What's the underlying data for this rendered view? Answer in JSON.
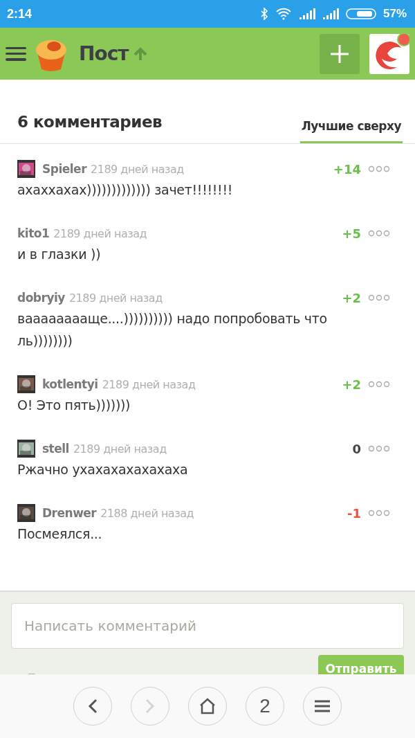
{
  "status_bar": {
    "time": "2:14",
    "battery": "57%"
  },
  "header": {
    "title": "Пост"
  },
  "comments_header": {
    "count": "6 комментариев",
    "sort_tab": {
      "label": "Лучшие сверху",
      "selected": true
    }
  },
  "comments": [
    {
      "author": "Spieler",
      "age": "2189 дней назад",
      "score": "+14",
      "color": "#6abf4b",
      "avatar": true,
      "text": "ахаххахах))))))))))))) зачет!!!!!!!!"
    },
    {
      "author": "kito1",
      "age": "2189 дней назад",
      "score": "+5",
      "color": "#6abf4b",
      "avatar": false,
      "text": "и в глазки ))"
    },
    {
      "author": "dobryiy",
      "age": "2189 дней назад",
      "score": "+2",
      "color": "#6abf4b",
      "avatar": false,
      "text": "вааааааааще....)))))))))) надо попробовать что ль))))))))"
    },
    {
      "author": "kotlentyi",
      "age": "2189 дней назад",
      "score": "+2",
      "color": "#6abf4b",
      "avatar": true,
      "text": "О! Это пять)))))))"
    },
    {
      "author": "stell",
      "age": "2189 дней назад",
      "score": "0",
      "color": "#444444",
      "avatar": true,
      "text": "Ржачно ухахахахахахаха"
    },
    {
      "author": "Drenwer",
      "age": "2188 дней назад",
      "score": "-1",
      "color": "#f0503c",
      "avatar": true,
      "text": "Посмеялся..."
    }
  ],
  "compose": {
    "placeholder": "Написать комментарий",
    "send": "Отправить"
  },
  "browser_bar": [
    {
      "kind": "back",
      "disabled": false
    },
    {
      "kind": "forward",
      "disabled": true
    },
    {
      "kind": "home",
      "disabled": false
    },
    {
      "kind": "tabs",
      "label": "2",
      "disabled": false
    },
    {
      "kind": "menu",
      "disabled": false
    }
  ]
}
